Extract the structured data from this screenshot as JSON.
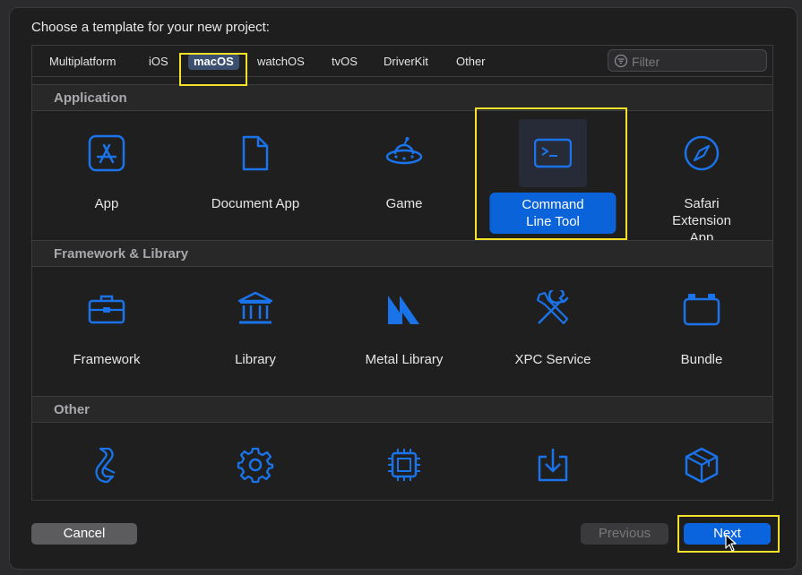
{
  "title": "Choose a template for your new project:",
  "tabs": [
    {
      "label": "Multiplatform"
    },
    {
      "label": "iOS"
    },
    {
      "label": "macOS",
      "selected": true
    },
    {
      "label": "watchOS"
    },
    {
      "label": "tvOS"
    },
    {
      "label": "DriverKit"
    },
    {
      "label": "Other"
    }
  ],
  "filter": {
    "placeholder": "Filter",
    "value": ""
  },
  "sections": [
    {
      "title": "Application",
      "items": [
        {
          "label": "App",
          "icon": "app-store-icon"
        },
        {
          "label": "Document App",
          "icon": "document-icon"
        },
        {
          "label": "Game",
          "icon": "ufo-icon"
        },
        {
          "label": "Command\nLine Tool",
          "icon": "terminal-icon",
          "selected": true
        },
        {
          "label": "Safari Extension\nApp",
          "icon": "compass-icon"
        }
      ]
    },
    {
      "title": "Framework & Library",
      "items": [
        {
          "label": "Framework",
          "icon": "toolbox-icon"
        },
        {
          "label": "Library",
          "icon": "building-columns-icon"
        },
        {
          "label": "Metal Library",
          "icon": "metal-icon"
        },
        {
          "label": "XPC Service",
          "icon": "wrench-screwdriver-icon"
        },
        {
          "label": "Bundle",
          "icon": "bundle-icon"
        }
      ]
    },
    {
      "title": "Other",
      "items": [
        {
          "label": "",
          "icon": "swift-script-icon"
        },
        {
          "label": "",
          "icon": "gear-icon"
        },
        {
          "label": "",
          "icon": "chip-icon"
        },
        {
          "label": "",
          "icon": "download-tray-icon"
        },
        {
          "label": "",
          "icon": "package-box-icon"
        }
      ]
    }
  ],
  "buttons": {
    "cancel": "Cancel",
    "previous": "Previous",
    "next": "Next"
  },
  "colors": {
    "accent": "#0b63d9",
    "icon_blue": "#1a73e8",
    "highlight": "#f5e12a"
  }
}
